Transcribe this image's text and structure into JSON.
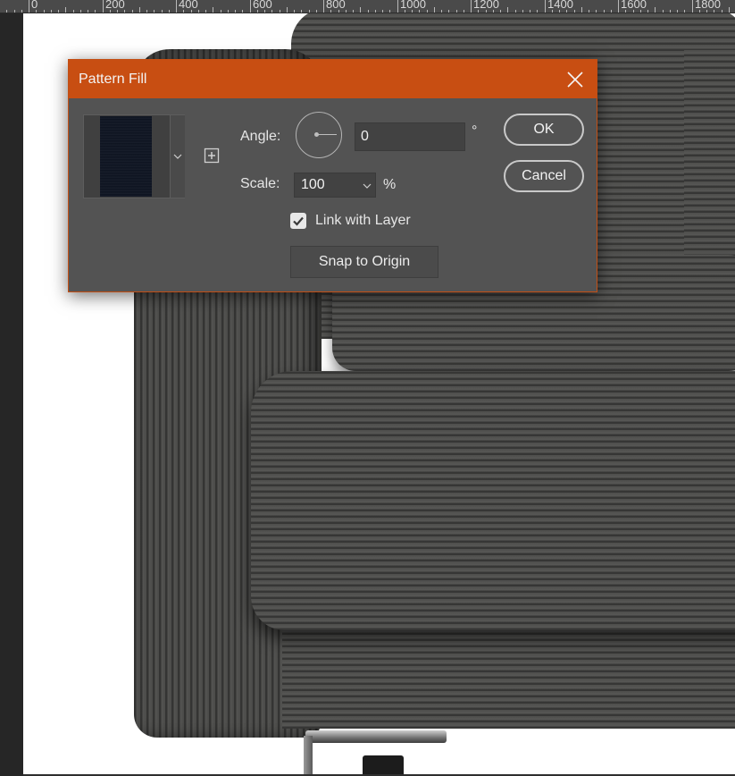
{
  "ruler": {
    "labels": [
      "0",
      "200",
      "400",
      "600",
      "800",
      "1000",
      "1200",
      "1400",
      "1600",
      "1800"
    ]
  },
  "dialog": {
    "title": "Pattern Fill",
    "angle_label": "Angle:",
    "angle_value": "0",
    "angle_unit": "°",
    "scale_label": "Scale:",
    "scale_value": "100",
    "scale_unit": "%",
    "link_with_layer_label": "Link with Layer",
    "link_with_layer_checked": true,
    "snap_to_origin_label": "Snap to Origin",
    "ok_label": "OK",
    "cancel_label": "Cancel",
    "pattern_preview_color": "#0f1522"
  },
  "colors": {
    "titlebar": "#c84e12",
    "dialog_bg": "#535353",
    "canvas_bg": "#ffffff",
    "ruler_bg": "#4a4a4a"
  },
  "icons": {
    "close": "close-icon",
    "new_preset": "add-square-icon",
    "dropdown": "chevron-down-icon",
    "checkbox": "checkmark-icon"
  }
}
